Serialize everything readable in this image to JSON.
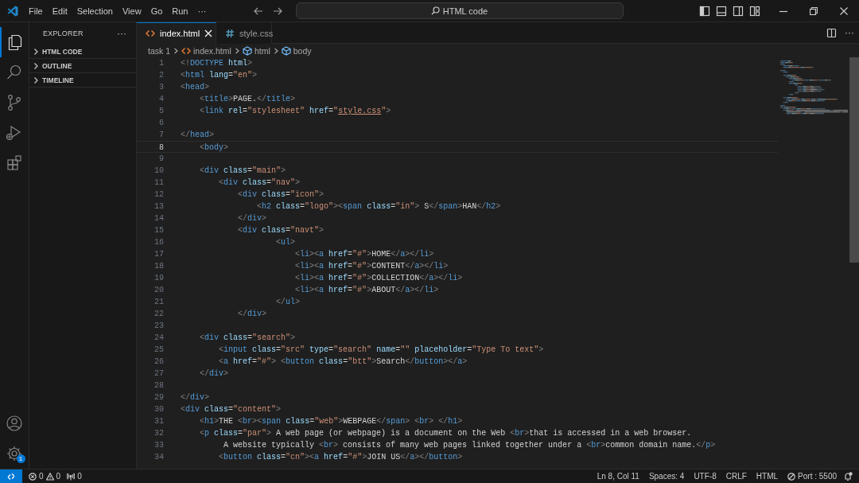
{
  "title_bar": {
    "menu": [
      "File",
      "Edit",
      "Selection",
      "View",
      "Go",
      "Run",
      "···"
    ],
    "command_center": "HTML code"
  },
  "activity_bar": {
    "manage_badge": "1"
  },
  "sidebar": {
    "title": "EXPLORER",
    "more": "···",
    "sections": [
      {
        "label": "HTML CODE",
        "expanded": false
      },
      {
        "label": "OUTLINE",
        "expanded": false
      },
      {
        "label": "TIMELINE",
        "expanded": false
      }
    ]
  },
  "editor": {
    "tabs": [
      {
        "label": "index.html",
        "kind": "html",
        "selected": true
      },
      {
        "label": "style.css",
        "kind": "css",
        "selected": false
      }
    ],
    "more": "···",
    "breadcrumbs": [
      {
        "label": "task 1",
        "kind": "folder"
      },
      {
        "label": "index.html",
        "kind": "html"
      },
      {
        "label": "html",
        "kind": "element"
      },
      {
        "label": "body",
        "kind": "element"
      }
    ],
    "lines": [
      {
        "number": "1",
        "current": false,
        "tokens": [
          {
            "kind": "punct",
            "text": "<!"
          },
          {
            "kind": "tag",
            "text": "DOCTYPE"
          },
          {
            "kind": "attr",
            "text": " html"
          },
          {
            "kind": "punct",
            "text": ">"
          }
        ]
      },
      {
        "number": "2",
        "current": false,
        "tokens": [
          {
            "kind": "punct",
            "text": "<"
          },
          {
            "kind": "tag",
            "text": "html"
          },
          {
            "kind": "attr",
            "text": " lang"
          },
          {
            "kind": "op",
            "text": "="
          },
          {
            "kind": "str",
            "text": "\"en\""
          },
          {
            "kind": "punct",
            "text": ">"
          }
        ]
      },
      {
        "number": "3",
        "current": false,
        "tokens": [
          {
            "kind": "punct",
            "text": "<"
          },
          {
            "kind": "tag",
            "text": "head"
          },
          {
            "kind": "punct",
            "text": ">"
          }
        ]
      },
      {
        "number": "4",
        "current": false,
        "tokens": [
          {
            "kind": "punct",
            "text": "    <"
          },
          {
            "kind": "tag",
            "text": "title"
          },
          {
            "kind": "punct",
            "text": ">"
          },
          {
            "kind": "text",
            "text": "PAGE."
          },
          {
            "kind": "punct",
            "text": "</"
          },
          {
            "kind": "tag",
            "text": "title"
          },
          {
            "kind": "punct",
            "text": ">"
          }
        ]
      },
      {
        "number": "5",
        "current": false,
        "tokens": [
          {
            "kind": "punct",
            "text": "    <"
          },
          {
            "kind": "tag",
            "text": "link"
          },
          {
            "kind": "attr",
            "text": " rel"
          },
          {
            "kind": "op",
            "text": "="
          },
          {
            "kind": "str",
            "text": "\"stylesheet\""
          },
          {
            "kind": "attr",
            "text": " href"
          },
          {
            "kind": "op",
            "text": "="
          },
          {
            "kind": "str",
            "text": "\""
          },
          {
            "kind": "link",
            "text": "style.css"
          },
          {
            "kind": "str",
            "text": "\""
          },
          {
            "kind": "punct",
            "text": ">"
          }
        ]
      },
      {
        "number": "6",
        "current": false
      },
      {
        "number": "7",
        "current": false,
        "tokens": [
          {
            "kind": "punct",
            "text": "</"
          },
          {
            "kind": "tag",
            "text": "head"
          },
          {
            "kind": "punct",
            "text": ">"
          }
        ]
      },
      {
        "number": "8",
        "current": true,
        "tokens": [
          {
            "kind": "punct",
            "text": "    <"
          },
          {
            "kind": "tag",
            "text": "body"
          },
          {
            "kind": "punct",
            "text": ">"
          }
        ]
      },
      {
        "number": "9",
        "current": false
      },
      {
        "number": "10",
        "current": false,
        "tokens": [
          {
            "kind": "punct",
            "text": "    <"
          },
          {
            "kind": "tag",
            "text": "div"
          },
          {
            "kind": "attr",
            "text": " class"
          },
          {
            "kind": "op",
            "text": "="
          },
          {
            "kind": "str",
            "text": "\"main\""
          },
          {
            "kind": "punct",
            "text": ">"
          }
        ]
      },
      {
        "number": "11",
        "current": false,
        "tokens": [
          {
            "kind": "punct",
            "text": "        <"
          },
          {
            "kind": "tag",
            "text": "div"
          },
          {
            "kind": "attr",
            "text": " class"
          },
          {
            "kind": "op",
            "text": "="
          },
          {
            "kind": "str",
            "text": "\"nav\""
          },
          {
            "kind": "punct",
            "text": ">"
          }
        ]
      },
      {
        "number": "12",
        "current": false,
        "tokens": [
          {
            "kind": "punct",
            "text": "            <"
          },
          {
            "kind": "tag",
            "text": "div"
          },
          {
            "kind": "attr",
            "text": " class"
          },
          {
            "kind": "op",
            "text": "="
          },
          {
            "kind": "str",
            "text": "\"icon\""
          },
          {
            "kind": "punct",
            "text": ">"
          }
        ]
      },
      {
        "number": "13",
        "current": false,
        "tokens": [
          {
            "kind": "punct",
            "text": "                <"
          },
          {
            "kind": "tag",
            "text": "h2"
          },
          {
            "kind": "attr",
            "text": " class"
          },
          {
            "kind": "op",
            "text": "="
          },
          {
            "kind": "str",
            "text": "\"logo\""
          },
          {
            "kind": "punct",
            "text": "><"
          },
          {
            "kind": "tag",
            "text": "span"
          },
          {
            "kind": "attr",
            "text": " class"
          },
          {
            "kind": "op",
            "text": "="
          },
          {
            "kind": "str",
            "text": "\"in\""
          },
          {
            "kind": "punct",
            "text": ">"
          },
          {
            "kind": "text",
            "text": " S"
          },
          {
            "kind": "punct",
            "text": "</"
          },
          {
            "kind": "tag",
            "text": "span"
          },
          {
            "kind": "punct",
            "text": ">"
          },
          {
            "kind": "text",
            "text": "HAN"
          },
          {
            "kind": "punct",
            "text": "</"
          },
          {
            "kind": "tag",
            "text": "h2"
          },
          {
            "kind": "punct",
            "text": ">"
          }
        ]
      },
      {
        "number": "14",
        "current": false,
        "tokens": [
          {
            "kind": "punct",
            "text": "            </"
          },
          {
            "kind": "tag",
            "text": "div"
          },
          {
            "kind": "punct",
            "text": ">"
          }
        ]
      },
      {
        "number": "15",
        "current": false,
        "tokens": [
          {
            "kind": "punct",
            "text": "            <"
          },
          {
            "kind": "tag",
            "text": "div"
          },
          {
            "kind": "attr",
            "text": " class"
          },
          {
            "kind": "op",
            "text": "="
          },
          {
            "kind": "str",
            "text": "\"navt\""
          },
          {
            "kind": "punct",
            "text": ">"
          }
        ]
      },
      {
        "number": "16",
        "current": false,
        "tokens": [
          {
            "kind": "punct",
            "text": "                    <"
          },
          {
            "kind": "tag",
            "text": "ul"
          },
          {
            "kind": "punct",
            "text": ">"
          }
        ]
      },
      {
        "number": "17",
        "current": false,
        "tokens": [
          {
            "kind": "punct",
            "text": "                        <"
          },
          {
            "kind": "tag",
            "text": "li"
          },
          {
            "kind": "punct",
            "text": "><"
          },
          {
            "kind": "tag",
            "text": "a"
          },
          {
            "kind": "attr",
            "text": " href"
          },
          {
            "kind": "op",
            "text": "="
          },
          {
            "kind": "str",
            "text": "\"#\""
          },
          {
            "kind": "punct",
            "text": ">"
          },
          {
            "kind": "text",
            "text": "HOME"
          },
          {
            "kind": "punct",
            "text": "</"
          },
          {
            "kind": "tag",
            "text": "a"
          },
          {
            "kind": "punct",
            "text": "></"
          },
          {
            "kind": "tag",
            "text": "li"
          },
          {
            "kind": "punct",
            "text": ">"
          }
        ]
      },
      {
        "number": "18",
        "current": false,
        "tokens": [
          {
            "kind": "punct",
            "text": "                        <"
          },
          {
            "kind": "tag",
            "text": "li"
          },
          {
            "kind": "punct",
            "text": "><"
          },
          {
            "kind": "tag",
            "text": "a"
          },
          {
            "kind": "attr",
            "text": " href"
          },
          {
            "kind": "op",
            "text": "="
          },
          {
            "kind": "str",
            "text": "\"#\""
          },
          {
            "kind": "punct",
            "text": ">"
          },
          {
            "kind": "text",
            "text": "CONTENT"
          },
          {
            "kind": "punct",
            "text": "</"
          },
          {
            "kind": "tag",
            "text": "a"
          },
          {
            "kind": "punct",
            "text": "></"
          },
          {
            "kind": "tag",
            "text": "li"
          },
          {
            "kind": "punct",
            "text": ">"
          }
        ]
      },
      {
        "number": "19",
        "current": false,
        "tokens": [
          {
            "kind": "punct",
            "text": "                        <"
          },
          {
            "kind": "tag",
            "text": "li"
          },
          {
            "kind": "punct",
            "text": "><"
          },
          {
            "kind": "tag",
            "text": "a"
          },
          {
            "kind": "attr",
            "text": " href"
          },
          {
            "kind": "op",
            "text": "="
          },
          {
            "kind": "str",
            "text": "\"#\""
          },
          {
            "kind": "punct",
            "text": ">"
          },
          {
            "kind": "text",
            "text": "COLLECTION"
          },
          {
            "kind": "punct",
            "text": "</"
          },
          {
            "kind": "tag",
            "text": "a"
          },
          {
            "kind": "punct",
            "text": "></"
          },
          {
            "kind": "tag",
            "text": "li"
          },
          {
            "kind": "punct",
            "text": ">"
          }
        ]
      },
      {
        "number": "20",
        "current": false,
        "tokens": [
          {
            "kind": "punct",
            "text": "                        <"
          },
          {
            "kind": "tag",
            "text": "li"
          },
          {
            "kind": "punct",
            "text": "><"
          },
          {
            "kind": "tag",
            "text": "a"
          },
          {
            "kind": "attr",
            "text": " href"
          },
          {
            "kind": "op",
            "text": "="
          },
          {
            "kind": "str",
            "text": "\"#\""
          },
          {
            "kind": "punct",
            "text": ">"
          },
          {
            "kind": "text",
            "text": "ABOUT"
          },
          {
            "kind": "punct",
            "text": "</"
          },
          {
            "kind": "tag",
            "text": "a"
          },
          {
            "kind": "punct",
            "text": "></"
          },
          {
            "kind": "tag",
            "text": "li"
          },
          {
            "kind": "punct",
            "text": ">"
          }
        ]
      },
      {
        "number": "21",
        "current": false,
        "tokens": [
          {
            "kind": "punct",
            "text": "                    </"
          },
          {
            "kind": "tag",
            "text": "ul"
          },
          {
            "kind": "punct",
            "text": ">"
          }
        ]
      },
      {
        "number": "22",
        "current": false,
        "tokens": [
          {
            "kind": "punct",
            "text": "            </"
          },
          {
            "kind": "tag",
            "text": "div"
          },
          {
            "kind": "punct",
            "text": ">"
          }
        ]
      },
      {
        "number": "23",
        "current": false
      },
      {
        "number": "24",
        "current": false,
        "tokens": [
          {
            "kind": "punct",
            "text": "    <"
          },
          {
            "kind": "tag",
            "text": "div"
          },
          {
            "kind": "attr",
            "text": " class"
          },
          {
            "kind": "op",
            "text": "="
          },
          {
            "kind": "str",
            "text": "\"search\""
          },
          {
            "kind": "punct",
            "text": ">"
          }
        ]
      },
      {
        "number": "25",
        "current": false,
        "tokens": [
          {
            "kind": "punct",
            "text": "        <"
          },
          {
            "kind": "tag",
            "text": "input"
          },
          {
            "kind": "attr",
            "text": " class"
          },
          {
            "kind": "op",
            "text": "="
          },
          {
            "kind": "str",
            "text": "\"src\""
          },
          {
            "kind": "attr",
            "text": " type"
          },
          {
            "kind": "op",
            "text": "="
          },
          {
            "kind": "str",
            "text": "\"search\""
          },
          {
            "kind": "attr",
            "text": " name"
          },
          {
            "kind": "op",
            "text": "="
          },
          {
            "kind": "str",
            "text": "\"\""
          },
          {
            "kind": "attr",
            "text": " placeholder"
          },
          {
            "kind": "op",
            "text": "="
          },
          {
            "kind": "str",
            "text": "\"Type To text\""
          },
          {
            "kind": "punct",
            "text": ">"
          }
        ]
      },
      {
        "number": "26",
        "current": false,
        "tokens": [
          {
            "kind": "punct",
            "text": "        <"
          },
          {
            "kind": "tag",
            "text": "a"
          },
          {
            "kind": "attr",
            "text": " href"
          },
          {
            "kind": "op",
            "text": "="
          },
          {
            "kind": "str",
            "text": "\"#\""
          },
          {
            "kind": "punct",
            "text": "> <"
          },
          {
            "kind": "tag",
            "text": "button"
          },
          {
            "kind": "attr",
            "text": " class"
          },
          {
            "kind": "op",
            "text": "="
          },
          {
            "kind": "str",
            "text": "\"btt\""
          },
          {
            "kind": "punct",
            "text": ">"
          },
          {
            "kind": "text",
            "text": "Search"
          },
          {
            "kind": "punct",
            "text": "</"
          },
          {
            "kind": "tag",
            "text": "button"
          },
          {
            "kind": "punct",
            "text": "></"
          },
          {
            "kind": "tag",
            "text": "a"
          },
          {
            "kind": "punct",
            "text": ">"
          }
        ]
      },
      {
        "number": "27",
        "current": false,
        "tokens": [
          {
            "kind": "punct",
            "text": "    </"
          },
          {
            "kind": "tag",
            "text": "div"
          },
          {
            "kind": "punct",
            "text": ">"
          }
        ]
      },
      {
        "number": "28",
        "current": false
      },
      {
        "number": "29",
        "current": false,
        "tokens": [
          {
            "kind": "punct",
            "text": "</"
          },
          {
            "kind": "tag",
            "text": "div"
          },
          {
            "kind": "punct",
            "text": ">"
          }
        ]
      },
      {
        "number": "30",
        "current": false,
        "tokens": [
          {
            "kind": "punct",
            "text": "<"
          },
          {
            "kind": "tag",
            "text": "div"
          },
          {
            "kind": "attr",
            "text": " class"
          },
          {
            "kind": "op",
            "text": "="
          },
          {
            "kind": "str",
            "text": "\"content\""
          },
          {
            "kind": "punct",
            "text": ">"
          }
        ]
      },
      {
        "number": "31",
        "current": false,
        "tokens": [
          {
            "kind": "punct",
            "text": "    <"
          },
          {
            "kind": "tag",
            "text": "h1"
          },
          {
            "kind": "punct",
            "text": ">"
          },
          {
            "kind": "text",
            "text": "THE "
          },
          {
            "kind": "punct",
            "text": "<"
          },
          {
            "kind": "tag",
            "text": "br"
          },
          {
            "kind": "punct",
            "text": "><"
          },
          {
            "kind": "tag",
            "text": "span"
          },
          {
            "kind": "attr",
            "text": " class"
          },
          {
            "kind": "op",
            "text": "="
          },
          {
            "kind": "str",
            "text": "\"web\""
          },
          {
            "kind": "punct",
            "text": ">"
          },
          {
            "kind": "text",
            "text": "WEBPAGE"
          },
          {
            "kind": "punct",
            "text": "</"
          },
          {
            "kind": "tag",
            "text": "span"
          },
          {
            "kind": "punct",
            "text": "> <"
          },
          {
            "kind": "tag",
            "text": "br"
          },
          {
            "kind": "punct",
            "text": "> </"
          },
          {
            "kind": "tag",
            "text": "h1"
          },
          {
            "kind": "punct",
            "text": ">"
          }
        ]
      },
      {
        "number": "32",
        "current": false,
        "tokens": [
          {
            "kind": "punct",
            "text": "    <"
          },
          {
            "kind": "tag",
            "text": "p"
          },
          {
            "kind": "attr",
            "text": " class"
          },
          {
            "kind": "op",
            "text": "="
          },
          {
            "kind": "str",
            "text": "\"par\""
          },
          {
            "kind": "punct",
            "text": ">"
          },
          {
            "kind": "text",
            "text": " A web page (or webpage) is a document on the Web "
          },
          {
            "kind": "punct",
            "text": "<"
          },
          {
            "kind": "tag",
            "text": "br"
          },
          {
            "kind": "punct",
            "text": ">"
          },
          {
            "kind": "text",
            "text": "that is accessed in a web browser."
          }
        ]
      },
      {
        "number": "33",
        "current": false,
        "tokens": [
          {
            "kind": "text",
            "text": "         A website typically "
          },
          {
            "kind": "punct",
            "text": "<"
          },
          {
            "kind": "tag",
            "text": "br"
          },
          {
            "kind": "punct",
            "text": ">"
          },
          {
            "kind": "text",
            "text": " consists of many web pages linked together under a "
          },
          {
            "kind": "punct",
            "text": "<"
          },
          {
            "kind": "tag",
            "text": "br"
          },
          {
            "kind": "punct",
            "text": ">"
          },
          {
            "kind": "text",
            "text": "common domain name."
          },
          {
            "kind": "punct",
            "text": "</"
          },
          {
            "kind": "tag",
            "text": "p"
          },
          {
            "kind": "punct",
            "text": ">"
          }
        ]
      },
      {
        "number": "34",
        "current": false,
        "tokens": [
          {
            "kind": "punct",
            "text": "        <"
          },
          {
            "kind": "tag",
            "text": "button"
          },
          {
            "kind": "attr",
            "text": " class"
          },
          {
            "kind": "op",
            "text": "="
          },
          {
            "kind": "str",
            "text": "\"cn\""
          },
          {
            "kind": "punct",
            "text": "><"
          },
          {
            "kind": "tag",
            "text": "a"
          },
          {
            "kind": "attr",
            "text": " href"
          },
          {
            "kind": "op",
            "text": "="
          },
          {
            "kind": "str",
            "text": "\"#\""
          },
          {
            "kind": "punct",
            "text": ">"
          },
          {
            "kind": "text",
            "text": "JOIN US"
          },
          {
            "kind": "punct",
            "text": "</"
          },
          {
            "kind": "tag",
            "text": "a"
          },
          {
            "kind": "punct",
            "text": "></"
          },
          {
            "kind": "tag",
            "text": "button"
          },
          {
            "kind": "punct",
            "text": ">"
          }
        ]
      }
    ]
  },
  "status_bar": {
    "errors": "0",
    "warnings": "0",
    "ports": "0",
    "items": [
      {
        "label": "Ln 8, Col 11",
        "kind": "text"
      },
      {
        "label": "Spaces: 4",
        "kind": "text"
      },
      {
        "label": "UTF-8",
        "kind": "text"
      },
      {
        "label": "CRLF",
        "kind": "text"
      },
      {
        "label": "HTML",
        "kind": "text"
      },
      {
        "label": "Port : 5500",
        "kind": "port"
      }
    ]
  }
}
